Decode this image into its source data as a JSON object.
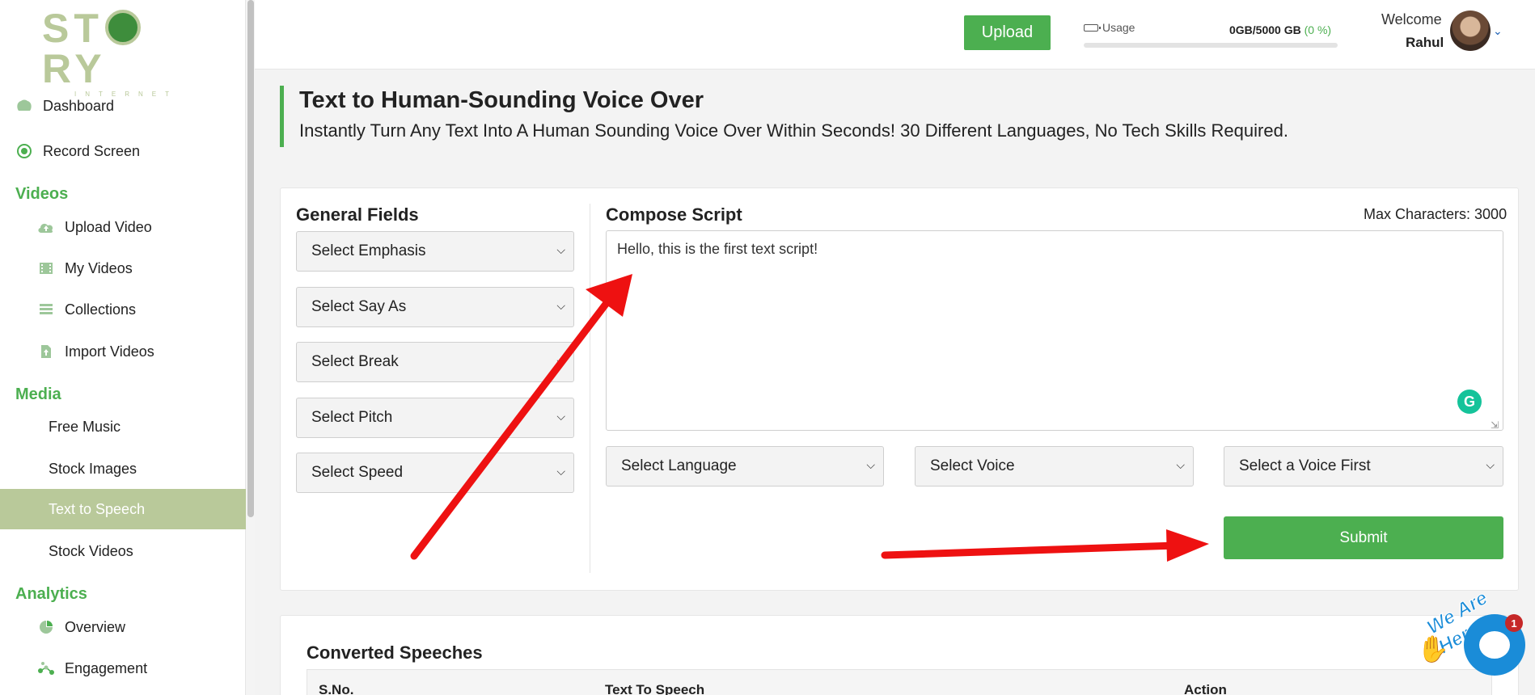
{
  "logo": {
    "text_left": "ST",
    "text_right": "RY",
    "subtitle": "INTERNET"
  },
  "sidebar": {
    "top_items": [
      {
        "label": "Dashboard",
        "icon": "brain-icon"
      },
      {
        "label": "Record Screen",
        "icon": "record-icon"
      }
    ],
    "sections": [
      {
        "title": "Videos",
        "items": [
          {
            "label": "Upload Video",
            "icon": "cloud-upload-icon"
          },
          {
            "label": "My Videos",
            "icon": "film-icon"
          },
          {
            "label": "Collections",
            "icon": "list-icon"
          },
          {
            "label": "Import Videos",
            "icon": "file-import-icon"
          }
        ]
      },
      {
        "title": "Media",
        "items": [
          {
            "label": "Free Music"
          },
          {
            "label": "Stock Images"
          },
          {
            "label": "Text to Speech",
            "active": true
          },
          {
            "label": "Stock Videos"
          }
        ]
      },
      {
        "title": "Analytics",
        "items": [
          {
            "label": "Overview",
            "icon": "pie-chart-icon"
          },
          {
            "label": "Engagement",
            "icon": "nodes-icon"
          }
        ]
      }
    ]
  },
  "topbar": {
    "upload_label": "Upload",
    "usage_label": "Usage",
    "usage_value": "0GB/5000 GB",
    "usage_percent": "(0 %)",
    "usage_fraction": 0,
    "welcome": "Welcome",
    "username": "Rahul"
  },
  "header": {
    "title": "Text to Human-Sounding Voice Over",
    "subtitle": "Instantly Turn Any Text Into A Human Sounding Voice Over Within Seconds! 30 Different Languages, No Tech Skills Required."
  },
  "general_fields": {
    "title": "General Fields",
    "selects": [
      "Select Emphasis",
      "Select Say As",
      "Select Break",
      "Select Pitch",
      "Select Speed"
    ]
  },
  "compose": {
    "title": "Compose Script",
    "max_chars": "Max Characters: 3000",
    "script_value": "Hello, this is the first text script!",
    "language": "Select Language",
    "voice": "Select Voice",
    "voice_dependent": "Select a Voice First",
    "submit": "Submit"
  },
  "converted": {
    "title": "Converted Speeches",
    "columns": [
      "S.No.",
      "Text To Speech",
      "Action"
    ]
  },
  "chat": {
    "tagline": "We Are Here!",
    "badge": "1"
  },
  "colors": {
    "accent": "#4caf50",
    "sidebar_active": "#b9c99a",
    "annotation_arrow": "#ee1111"
  }
}
